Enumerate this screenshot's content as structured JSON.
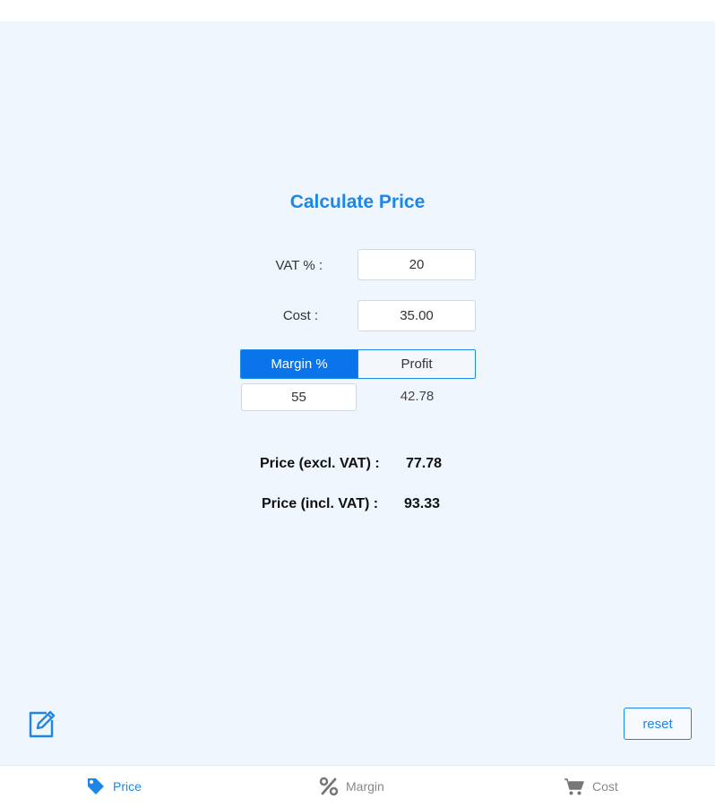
{
  "header": {
    "title": "Calculate Price"
  },
  "vat": {
    "label": "VAT % :",
    "value": "20"
  },
  "cost": {
    "label": "Cost :",
    "value": "35.00"
  },
  "mode_toggle": {
    "margin_label": "Margin %",
    "profit_label": "Profit",
    "selected": "Margin %"
  },
  "margin": {
    "value": "55"
  },
  "profit": {
    "value": "42.78"
  },
  "results": {
    "excl_label": "Price (excl. VAT) :",
    "excl_value": "77.78",
    "incl_label": "Price (incl. VAT) :",
    "incl_value": "93.33"
  },
  "actions": {
    "reset_label": "reset",
    "edit_icon": "edit-icon"
  },
  "tabs": [
    {
      "label": "Price",
      "icon": "tag-icon",
      "active": true
    },
    {
      "label": "Margin",
      "icon": "percent-icon",
      "active": false
    },
    {
      "label": "Cost",
      "icon": "cart-icon",
      "active": false
    }
  ],
  "colors": {
    "accent": "#1d87e8",
    "active_segment": "#0a74ea",
    "background": "#eff6fd",
    "inactive_tab": "#888888"
  }
}
